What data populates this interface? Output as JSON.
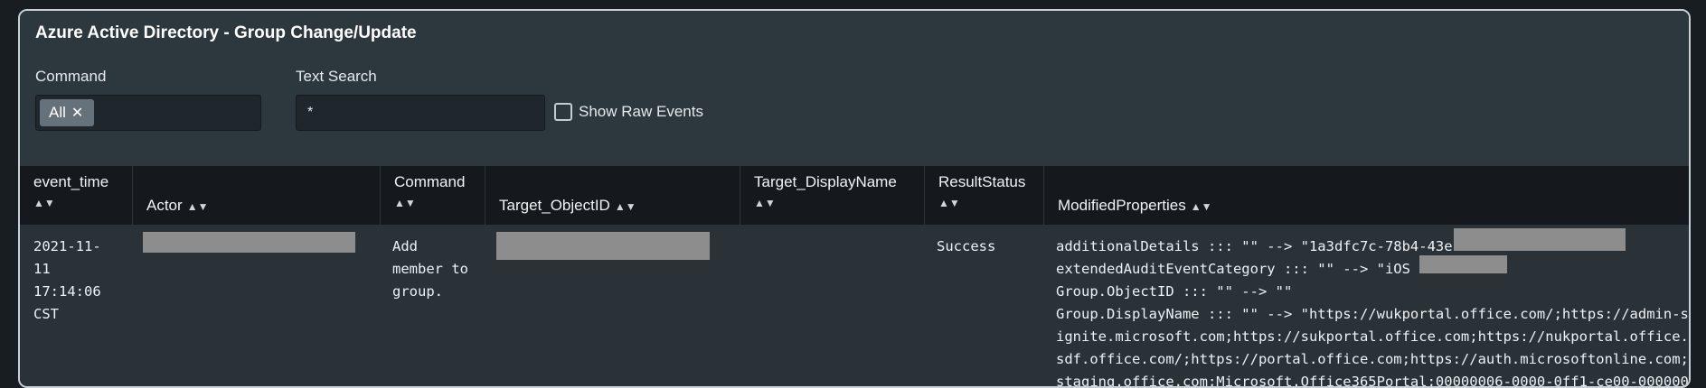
{
  "panel": {
    "title": "Azure Active Directory - Group Change/Update"
  },
  "inputs": {
    "command": {
      "label": "Command",
      "token": "All"
    },
    "text_search": {
      "label": "Text Search",
      "value": "*"
    },
    "raw_events": {
      "label": "Show Raw Events",
      "checked": false
    }
  },
  "table": {
    "columns": [
      "event_time",
      "Actor",
      "Command",
      "Target_ObjectID",
      "Target_DisplayName",
      "ResultStatus",
      "ModifiedProperties"
    ],
    "row": {
      "event_time": [
        "2021-11-",
        "11",
        "17:14:06",
        "CST"
      ],
      "command": [
        "Add",
        "member to",
        "group."
      ],
      "result_status": "Success",
      "modified_properties": [
        "additionalDetails ::: \"\" --> \"1a3dfc7c-78b4-43e",
        "extendedAuditEventCategory ::: \"\" --> \"iOS",
        "Group.ObjectID ::: \"\" --> \"\"",
        "Group.DisplayName ::: \"\" --> \"https://wukportal.office.com/;https://admin-s",
        "ignite.microsoft.com;https://sukportal.office.com;https://nukportal.office.",
        "sdf.office.com/;https://portal.office.com;https://auth.microsoftonline.com;",
        "staging.office.com;Microsoft.Office365Portal;00000006-0000-0ff1-ce00-000000"
      ],
      "extended_closing_quote": "\""
    }
  }
}
